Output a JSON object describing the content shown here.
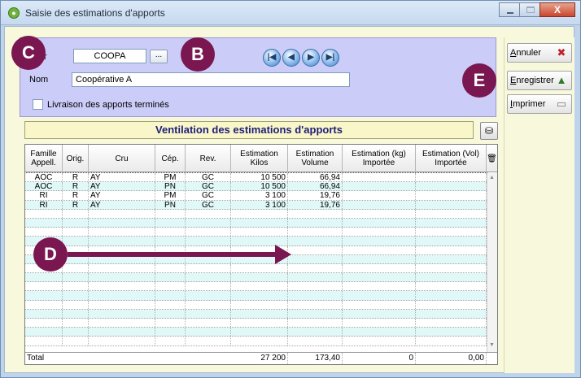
{
  "window": {
    "title": "Saisie des estimations d'apports",
    "close_glyph": "X"
  },
  "header": {
    "pressoir_label": "soir",
    "pressoir_value": "COOPA",
    "browse_label": "...",
    "nom_label": "Nom",
    "nom_value": "Coopérative A",
    "livraison_label": "Livraison des apports terminés",
    "nav": [
      "first-icon",
      "prev-icon",
      "next-icon",
      "last-icon"
    ]
  },
  "actions": {
    "annuler_u": "A",
    "annuler_rest": "nnuler",
    "enregistrer_u": "E",
    "enregistrer_rest": "nregistrer",
    "imprimer_u": "I",
    "imprimer_rest": "mprimer"
  },
  "grid": {
    "title": "Ventilation des estimations d'apports",
    "columns": [
      "Famille Appell.",
      "Orig.",
      "Cru",
      "Cép.",
      "Rev.",
      "Estimation Kilos",
      "Estimation Volume",
      "Estimation (kg) Importée",
      "Estimation (Vol) Importée"
    ],
    "rows": [
      [
        "AOC",
        "R",
        "AY",
        "PM",
        "GC",
        "10 500",
        "66,94",
        "",
        ""
      ],
      [
        "AOC",
        "R",
        "AY",
        "PN",
        "GC",
        "10 500",
        "66,94",
        "",
        ""
      ],
      [
        "RI",
        "R",
        "AY",
        "PM",
        "GC",
        "3 100",
        "19,76",
        "",
        ""
      ],
      [
        "RI",
        "R",
        "AY",
        "PN",
        "GC",
        "3 100",
        "19,76",
        "",
        ""
      ]
    ],
    "total": {
      "label": "Total",
      "kilos": "27 200",
      "volume": "173,40",
      "kg_importee": "0",
      "vol_importee": "0,00"
    }
  },
  "annotations": {
    "badge_c": "C",
    "badge_b": "B",
    "badge_d": "D",
    "badge_e": "E"
  },
  "colors": {
    "header_panel": "#ccccf9",
    "annotation": "#7a1650",
    "grid_alt_row": "#e0f8f8"
  }
}
